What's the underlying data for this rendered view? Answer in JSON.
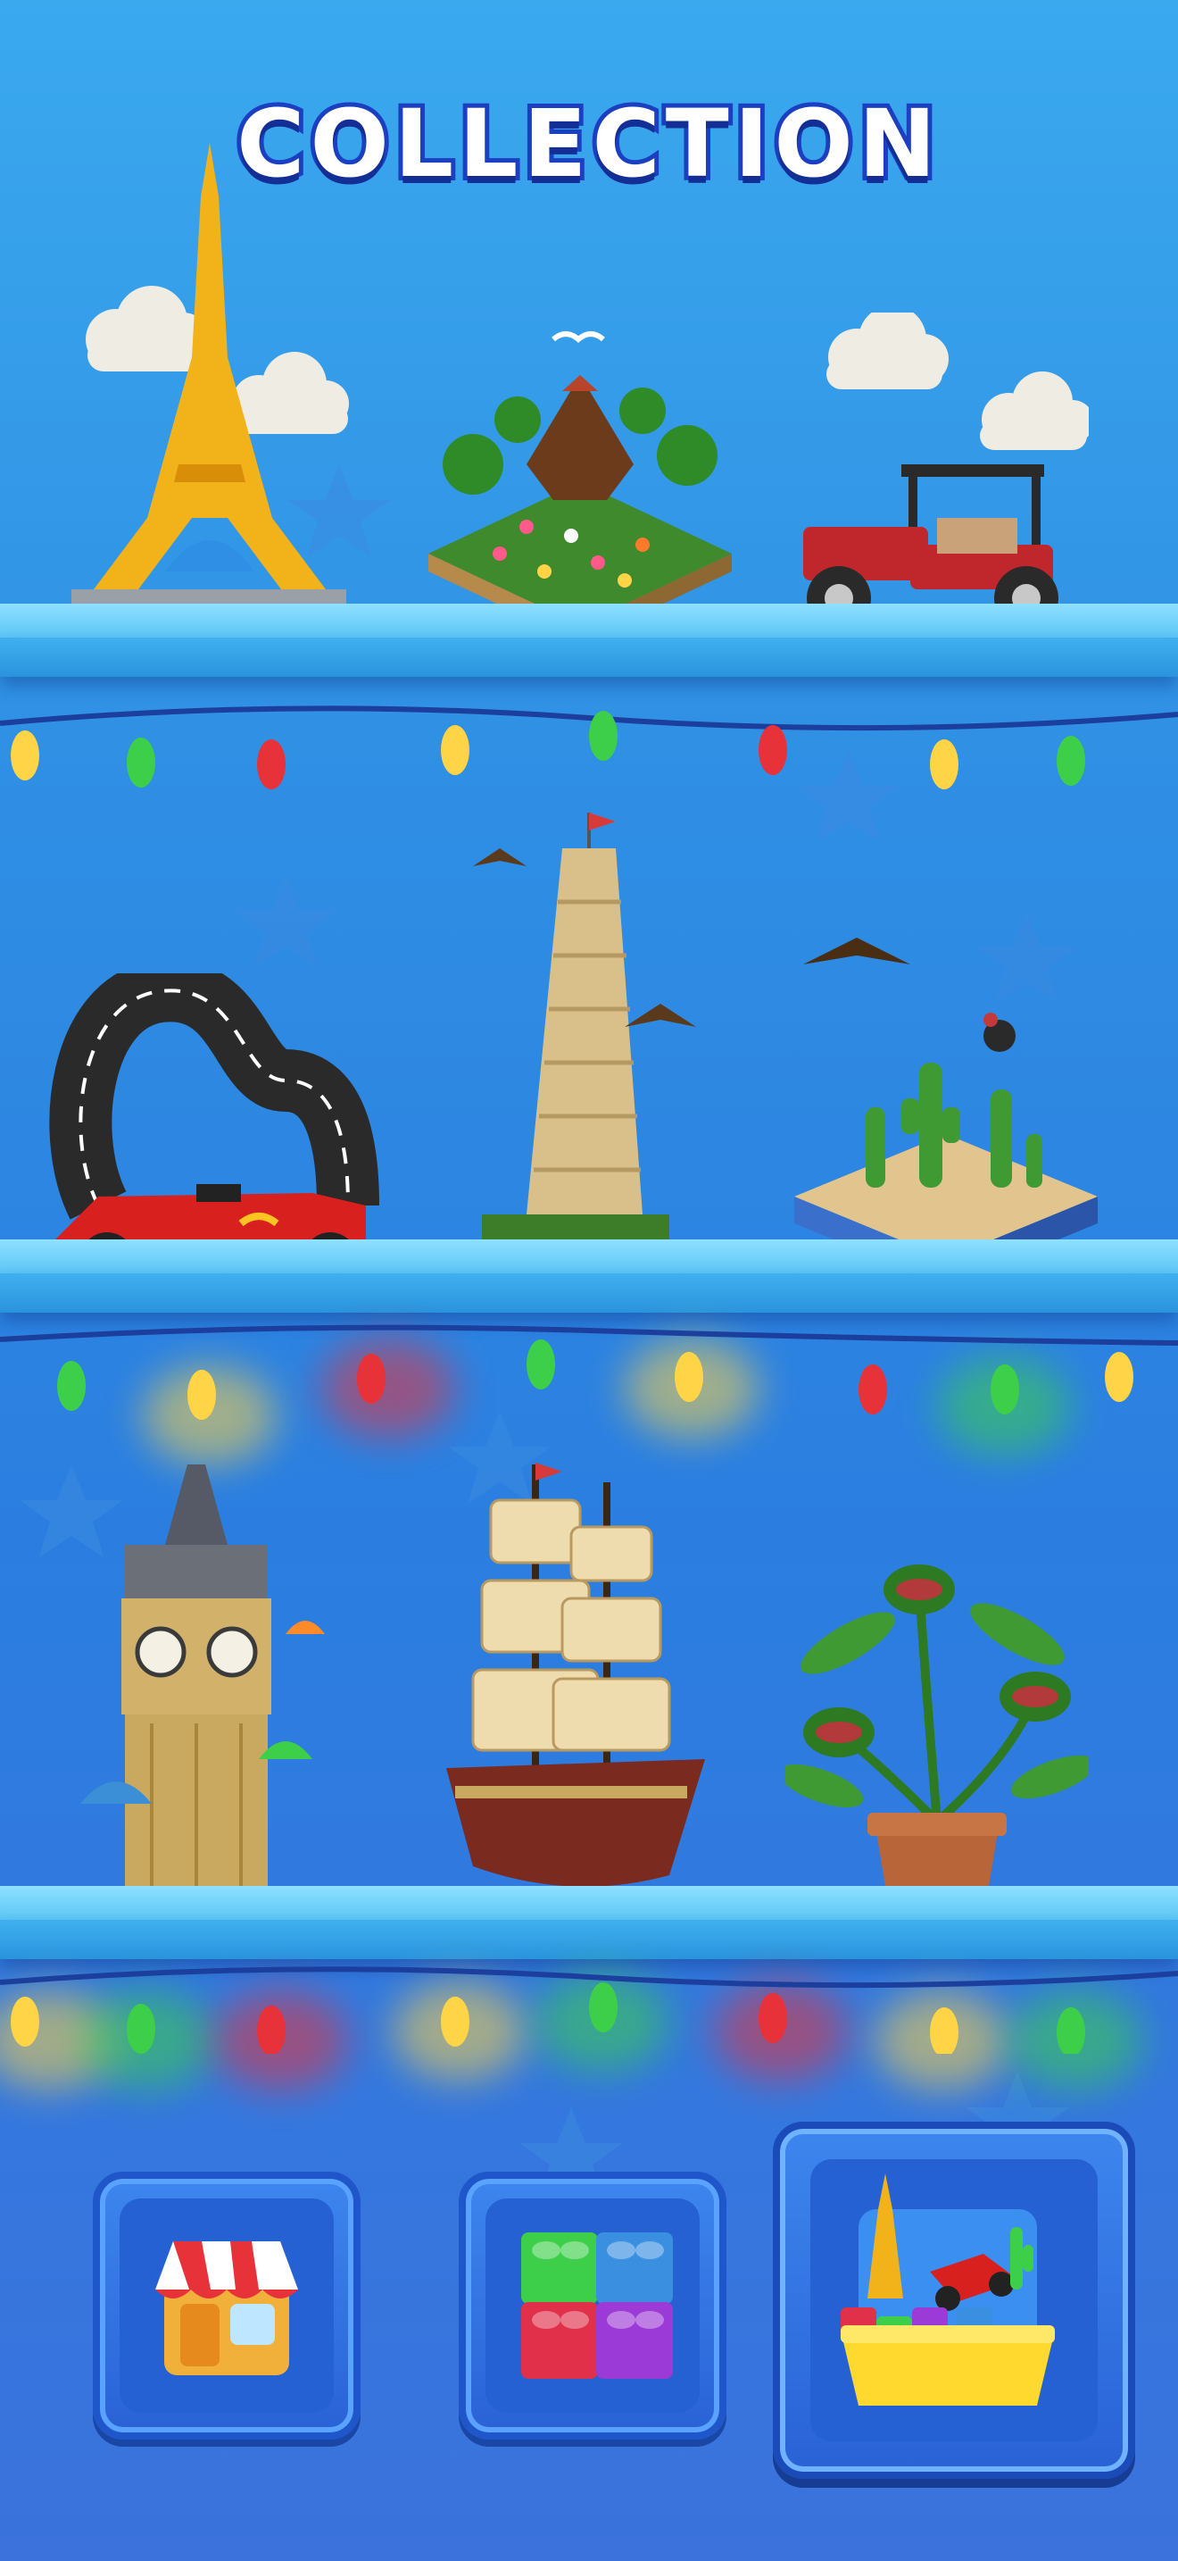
{
  "header": {
    "title": "COLLECTION"
  },
  "shelves": [
    {
      "items": [
        {
          "icon": "eiffel-tower-model"
        },
        {
          "icon": "volcano-island-model"
        },
        {
          "icon": "vintage-car-model"
        }
      ]
    },
    {
      "items": [
        {
          "icon": "race-track-model"
        },
        {
          "icon": "leaning-tower-model"
        },
        {
          "icon": "desert-cactus-model"
        }
      ]
    },
    {
      "items": [
        {
          "icon": "big-ben-model"
        },
        {
          "icon": "pirate-ship-model"
        },
        {
          "icon": "carnivorous-plant-model"
        }
      ]
    }
  ],
  "bottom_nav": {
    "items": [
      {
        "icon": "shop-icon",
        "selected": false
      },
      {
        "icon": "bricks-icon",
        "selected": false
      },
      {
        "icon": "collection-icon",
        "selected": true
      }
    ]
  },
  "colors": {
    "background": "#2f8fe4",
    "shelf": "#5cc6f5",
    "nav": "#2a62d6",
    "light_yellow": "#ffd447",
    "light_green": "#3ecf4a",
    "light_red": "#e8323a"
  }
}
